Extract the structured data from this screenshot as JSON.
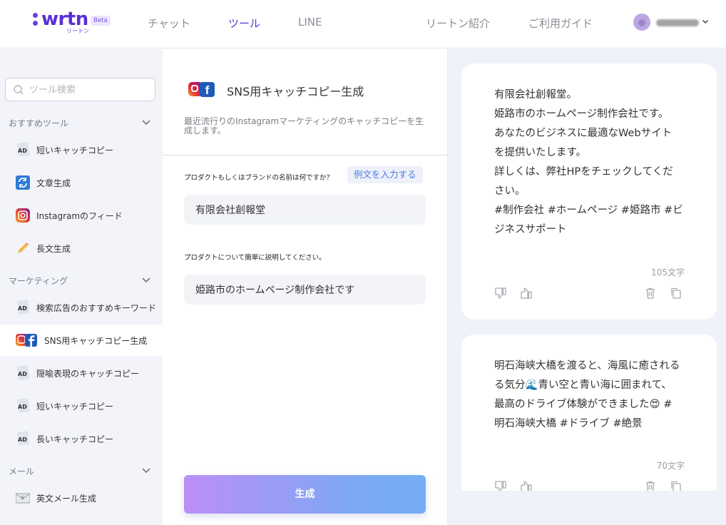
{
  "header": {
    "logo_text": "wrtn",
    "logo_sub": "リートン",
    "logo_badge": "Beta",
    "nav": [
      "チャット",
      "ツール",
      "LINE"
    ],
    "nav_active": "ツール",
    "right_links": [
      "リートン紹介",
      "ご利用ガイド"
    ]
  },
  "sidebar": {
    "search_placeholder": "ツール検索",
    "sections": [
      {
        "label": "おすすめツール",
        "items": [
          "短いキャッチコピー",
          "文章生成",
          "Instagramのフィード",
          "長文生成"
        ]
      },
      {
        "label": "マーケティング",
        "items": [
          "検索広告のおすすめキーワード",
          "SNS用キャッチコピー生成",
          "隠喩表現のキャッチコピー",
          "短いキャッチコピー",
          "長いキャッチコピー"
        ]
      },
      {
        "label": "メール",
        "items": [
          "英文メール生成"
        ]
      }
    ],
    "active_item": "SNS用キャッチコピー生成",
    "icons": [
      "ad-icon",
      "refresh-icon",
      "instagram-icon",
      "pencil-icon",
      "ad-icon",
      "sns-icon",
      "ad-icon",
      "ad-icon",
      "ad-icon",
      "envelope-icon"
    ]
  },
  "tool": {
    "title": "SNS用キャッチコピー生成",
    "description": "最近流行りのInstagramマーケティングのキャッチコピーを生成します。",
    "q1_label": "プロダクトもしくはブランドの名前は何ですか？",
    "example_button": "例文を入力する",
    "q1_value": "有限会社創報堂",
    "q2_label": "プロダクトについて簡単に説明してください。",
    "q2_value": "姫路市のホームページ制作会社です",
    "generate_button": "生成"
  },
  "results": [
    {
      "lines": [
        "有限会社創報堂。",
        "姫路市のホームページ制作会社です。",
        "あなたのビジネスに最適なWebサイト",
        "を提供いたします。",
        "詳しくは、弊社HPをチェックしてくだ",
        "さい。",
        "#制作会社 #ホームページ #姫路市 #ビ",
        "ジネスサポート"
      ],
      "char_count": "105文字"
    },
    {
      "lines": [
        "明石海峡大橋を渡ると、海風に癒される",
        "る気分🌊青い空と青い海に囲まれて、",
        "最高のドライブ体験ができました😍 #",
        "明石海峡大橋 #ドライブ #絶景"
      ],
      "char_count": "70文字"
    }
  ],
  "colors": {
    "brand": "#5b2fd6",
    "link": "#4a7ce0",
    "sidebar_bg": "#f2f4fa",
    "results_bg": "#eff2f8"
  }
}
